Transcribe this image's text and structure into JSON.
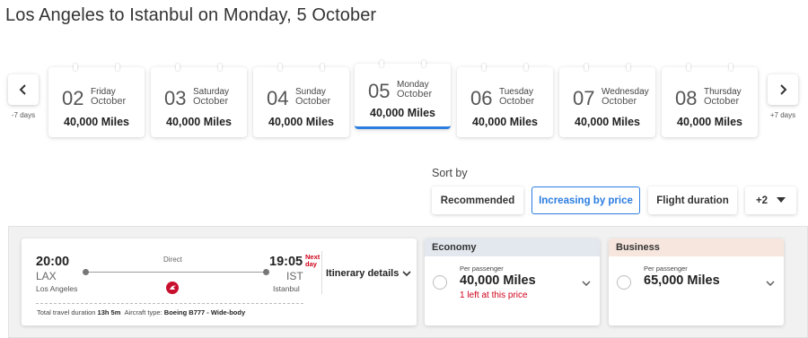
{
  "page_title": "Los Angeles to Istanbul on Monday, 5 October",
  "date_nav": {
    "prev_caption": "-7 days",
    "next_caption": "+7 days",
    "days": [
      {
        "day": "02",
        "weekday": "Friday",
        "month": "October",
        "price": "40,000 Miles",
        "selected": false
      },
      {
        "day": "03",
        "weekday": "Saturday",
        "month": "October",
        "price": "40,000 Miles",
        "selected": false
      },
      {
        "day": "04",
        "weekday": "Sunday",
        "month": "October",
        "price": "40,000 Miles",
        "selected": false
      },
      {
        "day": "05",
        "weekday": "Monday",
        "month": "October",
        "price": "40,000 Miles",
        "selected": true
      },
      {
        "day": "06",
        "weekday": "Tuesday",
        "month": "October",
        "price": "40,000 Miles",
        "selected": false
      },
      {
        "day": "07",
        "weekday": "Wednesday",
        "month": "October",
        "price": "40,000 Miles",
        "selected": false
      },
      {
        "day": "08",
        "weekday": "Thursday",
        "month": "October",
        "price": "40,000 Miles",
        "selected": false
      }
    ]
  },
  "sort": {
    "label": "Sort by",
    "options": [
      {
        "label": "Recommended",
        "active": false
      },
      {
        "label": "Increasing by price",
        "active": true
      },
      {
        "label": "Flight duration",
        "active": false
      }
    ],
    "more_label": "+2"
  },
  "flight": {
    "depart_time": "20:00",
    "depart_code": "LAX",
    "depart_city": "Los Angeles",
    "arrive_time": "19:05",
    "arrive_code": "IST",
    "arrive_city": "Istanbul",
    "next_day_line1": "Next",
    "next_day_line2": "day",
    "stops": "Direct",
    "airline_icon": "turkish-airlines-logo",
    "itinerary_label": "Itinerary details",
    "duration_label": "Total travel duration",
    "duration_value": "13h 5m",
    "aircraft_label": "Aircraft type:",
    "aircraft_value": "Boeing B777 - Wide-body"
  },
  "fares": [
    {
      "class": "Economy",
      "per": "Per passenger",
      "price": "40,000 Miles",
      "availability": "1 left at this price",
      "header_color": "#e3e7ee"
    },
    {
      "class": "Business",
      "per": "Per passenger",
      "price": "65,000 Miles",
      "availability": "",
      "header_color": "#f6e6dd"
    }
  ],
  "colors": {
    "accent": "#2b7de0",
    "alert": "#d0021b",
    "brand_red": "#c8102e"
  }
}
